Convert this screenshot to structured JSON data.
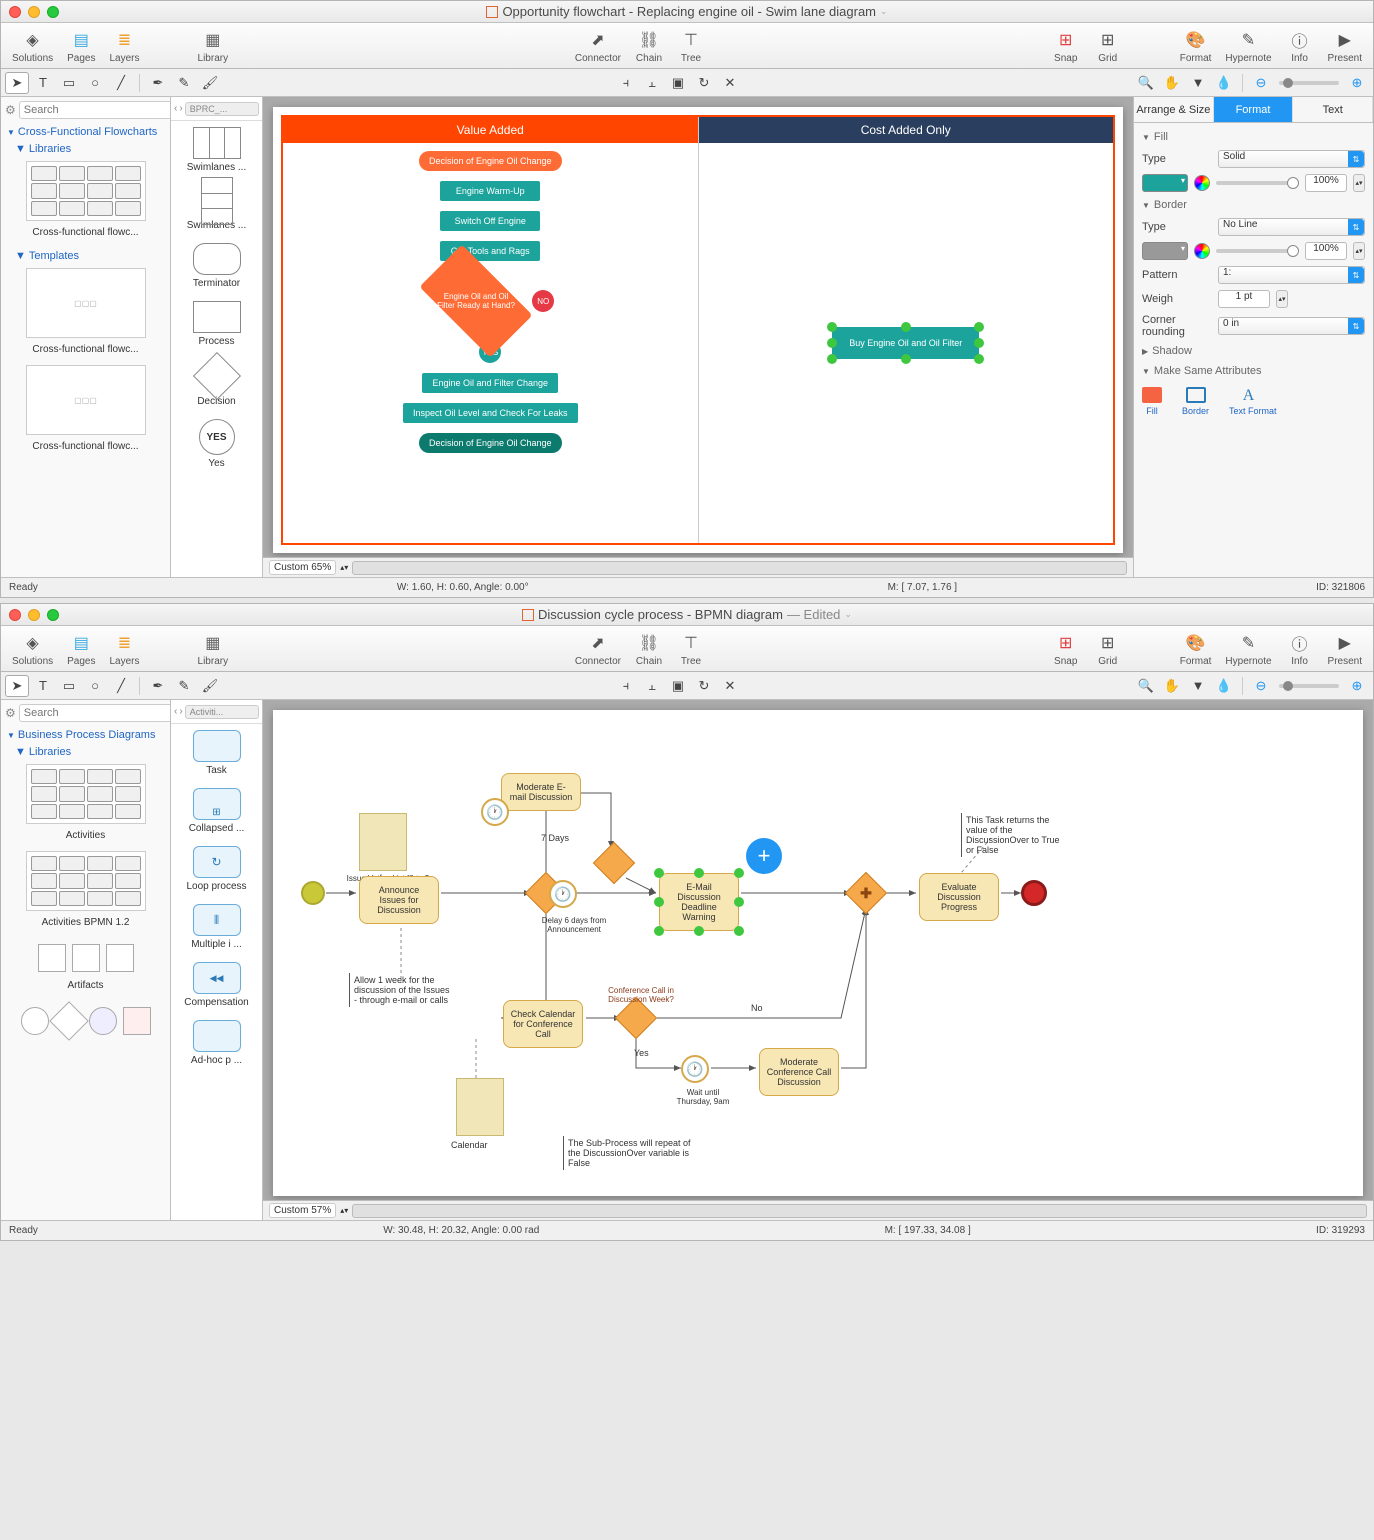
{
  "win1": {
    "title": "Opportunity flowchart - Replacing engine oil - Swim lane diagram",
    "toolbar": {
      "solutions": "Solutions",
      "pages": "Pages",
      "layers": "Layers",
      "library": "Library",
      "connector": "Connector",
      "chain": "Chain",
      "tree": "Tree",
      "snap": "Snap",
      "grid": "Grid",
      "format": "Format",
      "hypernote": "Hypernote",
      "info": "Info",
      "present": "Present"
    },
    "search_placeholder": "Search",
    "left": {
      "section": "Cross-Functional Flowcharts",
      "libraries": "Libraries",
      "lib1": "Cross-functional flowc...",
      "templates": "Templates",
      "tmpl1": "Cross-functional flowc...",
      "tmpl2": "Cross-functional flowc..."
    },
    "shapes": {
      "crumb": "BPRC_...",
      "items": [
        "Swimlanes  ...",
        "Swimlanes  ...",
        "Terminator",
        "Process",
        "Decision",
        "Yes"
      ]
    },
    "flowchart": {
      "lane1": "Value Added",
      "lane2": "Cost Added Only",
      "n1": "Decision of Engine Oil Change",
      "n2": "Engine Warm-Up",
      "n3": "Switch Off Engine",
      "n4": "Get Tools and Rags",
      "n5": "Engine Oil and Oil Filter Ready at Hand?",
      "no": "NO",
      "yes": "YES",
      "n6": "Buy Engine Oil and Oil Filter",
      "n7": "Engine Oil and Filter Change",
      "n8": "Inspect Oil Level and Check For Leaks",
      "n9": "Decision of Engine Oil Change"
    },
    "zoom": "Custom 65%",
    "inspector": {
      "tabs": {
        "arrange": "Arrange & Size",
        "format": "Format",
        "text": "Text"
      },
      "fill": "Fill",
      "type_label": "Type",
      "type_val": "Solid",
      "opacity": "100%",
      "border": "Border",
      "border_type": "No Line",
      "border_opacity": "100%",
      "pattern": "Pattern",
      "pattern_val": "1:",
      "weigh": "Weigh",
      "weigh_val": "1 pt",
      "corner": "Corner rounding",
      "corner_val": "0 in",
      "shadow": "Shadow",
      "make_same": "Make Same Attributes",
      "ms_fill": "Fill",
      "ms_border": "Border",
      "ms_text": "Text Format"
    },
    "status": {
      "ready": "Ready",
      "dims": "W: 1.60,  H: 0.60,  Angle: 0.00°",
      "mouse": "M: [ 7.07, 1.76 ]",
      "id": "ID: 321806"
    }
  },
  "win2": {
    "title": "Discussion cycle process - BPMN diagram",
    "edited": "— Edited",
    "toolbar": {
      "solutions": "Solutions",
      "pages": "Pages",
      "layers": "Layers",
      "library": "Library",
      "connector": "Connector",
      "chain": "Chain",
      "tree": "Tree",
      "snap": "Snap",
      "grid": "Grid",
      "format": "Format",
      "hypernote": "Hypernote",
      "info": "Info",
      "present": "Present"
    },
    "search_placeholder": "Search",
    "left": {
      "section": "Business Process Diagrams",
      "libraries": "Libraries",
      "lib1": "Activities",
      "lib2": "Activities BPMN 1.2",
      "lib3": "Artifacts"
    },
    "shapes": {
      "crumb": "Activiti...",
      "items": [
        "Task",
        "Collapsed  ...",
        "Loop process",
        "Multiple i ...",
        "Compensation",
        "Ad-hoc p ..."
      ]
    },
    "bpmn": {
      "issue_list": "Issue Voting List [0 to 5 Issues]",
      "announce": "Announce Issues for Discussion",
      "allow": "Allow 1 week for the discussion of the Issues - through e-mail or calls",
      "moderate_email": "Moderate E-mail Discussion",
      "seven_days": "7 Days",
      "delay": "Delay 6 days from Announcement",
      "deadline": "E-Mail Discussion Deadline Warning",
      "check_cal": "Check Calendar for Conference Call",
      "calendar": "Calendar",
      "conf_q": "Conference Call in Discussion Week?",
      "yes": "Yes",
      "no": "No",
      "wait": "Wait until Thursday, 9am",
      "moderate_call": "Moderate Conference Call Discussion",
      "evaluate": "Evaluate Discussion Progress",
      "returns": "This Task returns the value of the DiscussionOver to True or False",
      "subprocess": "The Sub-Process will repeat of the DiscussionOver variable is False"
    },
    "zoom": "Custom 57%",
    "status": {
      "ready": "Ready",
      "dims": "W: 30.48,  H: 20.32,  Angle: 0.00 rad",
      "mouse": "M: [ 197.33, 34.08 ]",
      "id": "ID: 319293"
    }
  }
}
